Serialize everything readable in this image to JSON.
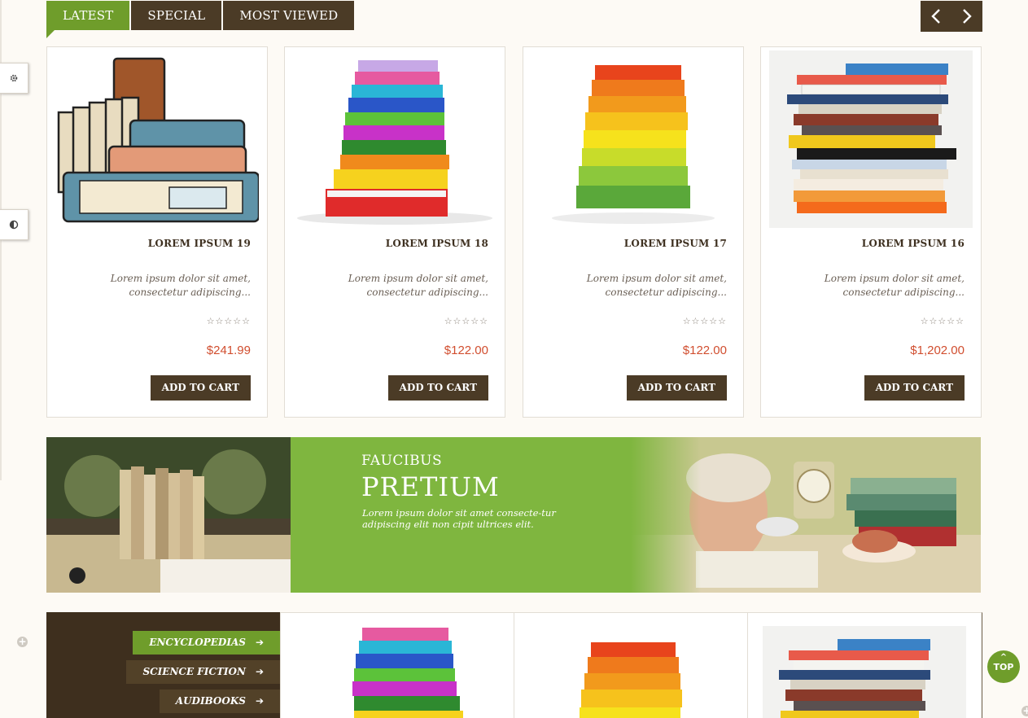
{
  "tabs": [
    {
      "label": "LATEST",
      "active": true
    },
    {
      "label": "SPECIAL",
      "active": false
    },
    {
      "label": "MOST VIEWED",
      "active": false
    }
  ],
  "products": [
    {
      "title": "LOREM IPSUM 19",
      "desc": "Lorem ipsum dolor sit amet, consectetur adipiscing...",
      "stars": "☆☆☆☆☆",
      "price": "$241.99",
      "cta": "ADD TO CART",
      "image": "cartoon-book-stack"
    },
    {
      "title": "LOREM IPSUM 18",
      "desc": "Lorem ipsum dolor sit amet, consectetur adipiscing...",
      "stars": "☆☆☆☆☆",
      "price": "$122.00",
      "cta": "ADD TO CART",
      "image": "colorful-book-stack"
    },
    {
      "title": "LOREM IPSUM 17",
      "desc": "Lorem ipsum dolor sit amet, consectetur adipiscing...",
      "stars": "☆☆☆☆☆",
      "price": "$122.00",
      "cta": "ADD TO CART",
      "image": "business-book-stack"
    },
    {
      "title": "LOREM IPSUM 16",
      "desc": "Lorem ipsum dolor sit amet, consectetur adipiscing...",
      "stars": "☆☆☆☆☆",
      "price": "$1,202.00",
      "cta": "ADD TO CART",
      "image": "photo-book-stack"
    }
  ],
  "banner": {
    "small": "FAUCIBUS",
    "big": "PRETIUM",
    "text": "Lorem ipsum dolor sit amet consecte-tur adipiscing elit non cipit ultrices elit."
  },
  "categories": [
    {
      "label": "ENCYCLOPEDIAS",
      "active": true
    },
    {
      "label": "SCIENCE FICTION",
      "active": false
    },
    {
      "label": "AUDIBOOKS",
      "active": false
    }
  ],
  "top_button": "TOP",
  "colors": {
    "brown": "#4b3b26",
    "green": "#6f9d2b",
    "price": "#d14e2f",
    "banner": "#7fb63f"
  }
}
